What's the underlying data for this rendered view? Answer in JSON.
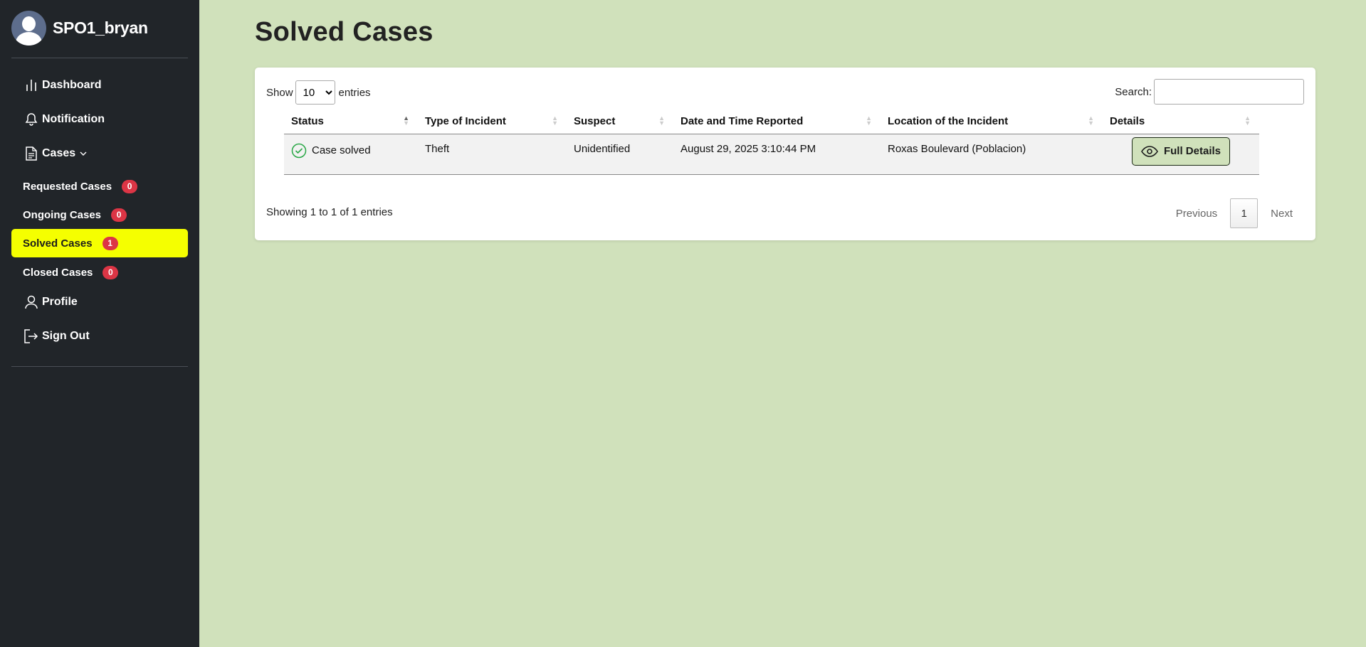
{
  "sidebar": {
    "username": "SPO1_bryan",
    "nav": {
      "dashboard": "Dashboard",
      "notification": "Notification",
      "cases": "Cases",
      "profile": "Profile",
      "sign_out": "Sign Out"
    },
    "sub_items": [
      {
        "label": "Requested Cases",
        "count": "0"
      },
      {
        "label": "Ongoing Cases",
        "count": "0"
      },
      {
        "label": "Solved Cases",
        "count": "1",
        "active": true
      },
      {
        "label": "Closed Cases",
        "count": "0"
      }
    ],
    "active_color": "#f5ff00",
    "badge_color": "#dc3545"
  },
  "main": {
    "title": "Solved Cases",
    "length": {
      "show": "Show",
      "value": "10",
      "entries": "entries"
    },
    "search_label": "Search:",
    "table": {
      "columns": [
        "Status",
        "Type of Incident",
        "Suspect",
        "Date and Time Reported",
        "Location of the Incident",
        "Details"
      ],
      "rows": [
        {
          "status": "Case solved",
          "type": "Theft",
          "suspect": "Unidentified",
          "date": "August 29, 2025 3:10:44 PM",
          "location": "Roxas Boulevard (Poblacion)",
          "details": "Full Details"
        }
      ]
    },
    "info": "Showing 1 to 1 of 1 entries",
    "pager": {
      "previous": "Previous",
      "page": "1",
      "next": "Next"
    }
  }
}
